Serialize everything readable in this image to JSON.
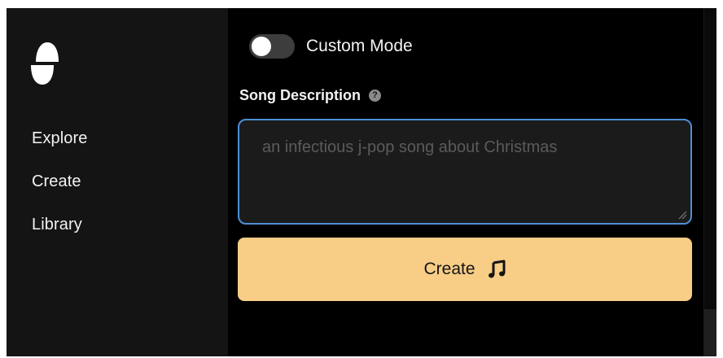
{
  "sidebar": {
    "logo_icon": "suno-wave-logo-icon",
    "items": [
      {
        "label": "Explore"
      },
      {
        "label": "Create"
      },
      {
        "label": "Library"
      }
    ]
  },
  "main": {
    "custom_mode": {
      "label": "Custom Mode",
      "enabled": false
    },
    "song_description": {
      "label": "Song Description",
      "help_icon": "question-circle-icon",
      "value": "",
      "placeholder": "an infectious j-pop song about Christmas"
    },
    "create_button": {
      "label": "Create",
      "icon": "music-note-icon"
    }
  },
  "colors": {
    "sidebar_bg": "#141414",
    "main_bg": "#000000",
    "accent": "#f8cd86",
    "focus_border": "#4d8fd6",
    "text": "#f2f2f2"
  }
}
